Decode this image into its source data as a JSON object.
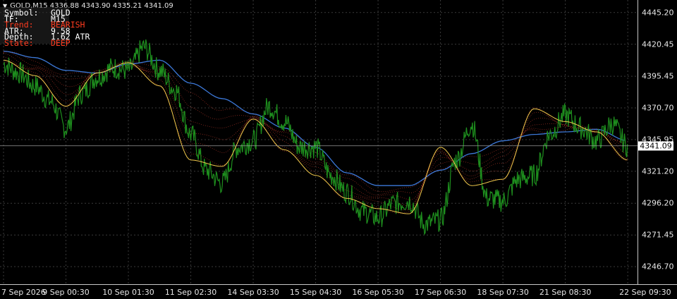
{
  "header": {
    "symbol_timeframe": "GOLD,M15",
    "ohlc": "4336.88 4343.90 4335.21 4341.09"
  },
  "info_panel": {
    "rows": [
      {
        "label": "Symbol:",
        "value": "GOLD",
        "color": "#ffffff"
      },
      {
        "label": "TF:",
        "value": "M15",
        "color": "#ffffff"
      },
      {
        "label": "Trend:",
        "value": "BEARISH",
        "color": "#ff3b1f"
      },
      {
        "label": "ATR:",
        "value": "9.58",
        "color": "#ffffff"
      },
      {
        "label": "Depth:",
        "value": "1.62 ATR",
        "color": "#ffffff"
      },
      {
        "label": "State:",
        "value": "DEEP",
        "color": "#ff3b1f"
      }
    ]
  },
  "current_price": "4341.09",
  "colors": {
    "background": "#000000",
    "grid": "#3a3a3a",
    "price_line": "#1e8f1e",
    "slow_ma": "#3c78d8",
    "fast_ma": "#f2c94c",
    "ribbon": "#c0392b",
    "text": "#e6e6e6"
  },
  "chart_data": {
    "type": "line",
    "title": "",
    "y_ticks": [
      "4445.20",
      "4420.45",
      "4395.45",
      "4370.70",
      "4345.95",
      "4321.20",
      "4296.20",
      "4271.45",
      "4246.70"
    ],
    "x_ticks": [
      "7 Sep 2026",
      "9 Sep 00:30",
      "10 Sep 01:30",
      "11 Sep 02:30",
      "14 Sep 03:30",
      "15 Sep 04:30",
      "16 Sep 05:30",
      "17 Sep 06:30",
      "18 Sep 07:30",
      "21 Sep 08:30",
      "22 Sep 09:30"
    ],
    "ylim": [
      4233,
      4455
    ],
    "grid": true,
    "series": [
      {
        "name": "",
        "x": [
          0,
          0.25,
          0.5,
          0.75,
          1,
          1.25,
          1.5,
          1.75,
          2,
          2.25,
          2.5,
          2.75,
          3,
          3.25,
          3.5,
          3.75,
          4,
          4.25,
          4.5,
          4.75,
          5,
          5.25,
          5.5,
          5.75,
          6,
          6.25,
          6.5,
          6.75,
          7,
          7.25,
          7.5,
          7.75,
          8,
          8.25,
          8.5,
          8.75,
          9,
          9.25,
          9.5,
          9.75,
          10
        ],
        "values": [
          4405,
          4398,
          4388,
          4376,
          4355,
          4382,
          4395,
          4402,
          4400,
          4418,
          4400,
          4385,
          4350,
          4322,
          4312,
          4340,
          4345,
          4372,
          4360,
          4340,
          4340,
          4318,
          4305,
          4290,
          4285,
          4296,
          4298,
          4280,
          4283,
          4330,
          4358,
          4300,
          4298,
          4315,
          4318,
          4350,
          4365,
          4355,
          4345,
          4358,
          4341
        ]
      },
      {
        "name": "",
        "x": [
          0,
          0.5,
          1,
          1.5,
          2,
          2.5,
          3,
          3.5,
          4,
          4.5,
          5,
          5.5,
          6,
          6.5,
          7,
          7.5,
          8,
          8.5,
          9,
          9.5,
          10
        ],
        "values": [
          4415,
          4410,
          4400,
          4398,
          4405,
          4408,
          4390,
          4378,
          4366,
          4355,
          4340,
          4320,
          4310,
          4310,
          4322,
          4335,
          4345,
          4350,
          4352,
          4354,
          4345
        ]
      },
      {
        "name": "",
        "x": [
          0,
          0.5,
          1,
          1.5,
          2,
          2.5,
          3,
          3.5,
          4,
          4.5,
          5,
          5.5,
          6,
          6.5,
          7,
          7.5,
          8,
          8.5,
          9,
          9.5,
          10
        ],
        "values": [
          4408,
          4396,
          4372,
          4398,
          4406,
          4388,
          4330,
          4325,
          4362,
          4338,
          4318,
          4300,
          4292,
          4288,
          4340,
          4310,
          4315,
          4370,
          4360,
          4352,
          4330
        ]
      }
    ]
  }
}
